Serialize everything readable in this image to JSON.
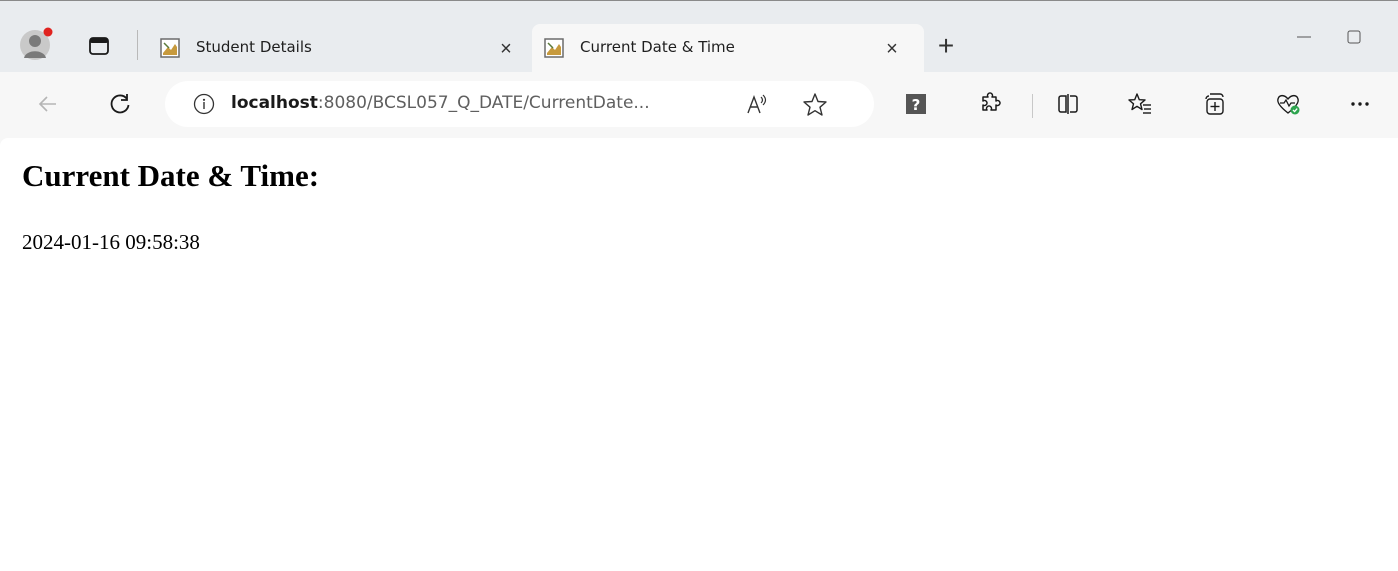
{
  "tabs": [
    {
      "title": "Student Details",
      "active": false,
      "close": "×"
    },
    {
      "title": "Current Date & Time",
      "active": true,
      "close": "×"
    }
  ],
  "new_tab": "+",
  "address_bar": {
    "host": "localhost",
    "rest": ":8080/BCSL057_Q_DATE/CurrentDate..."
  },
  "toolbar_icons": [
    "back-icon",
    "refresh-icon",
    "site-info-icon",
    "read-aloud-icon",
    "favorite-star-icon",
    "extension-help-icon",
    "extensions-icon",
    "split-screen-icon",
    "favorites-icon",
    "collections-icon",
    "browser-essentials-icon",
    "more-icon"
  ],
  "page": {
    "heading": "Current Date & Time:",
    "datetime": "2024-01-16 09:58:38"
  },
  "colors": {
    "tabstrip_bg": "#e9ecef",
    "toolbar_bg": "#f7f7f7",
    "profile_badge": "#e0231f",
    "essentials_badge": "#2da44e"
  }
}
